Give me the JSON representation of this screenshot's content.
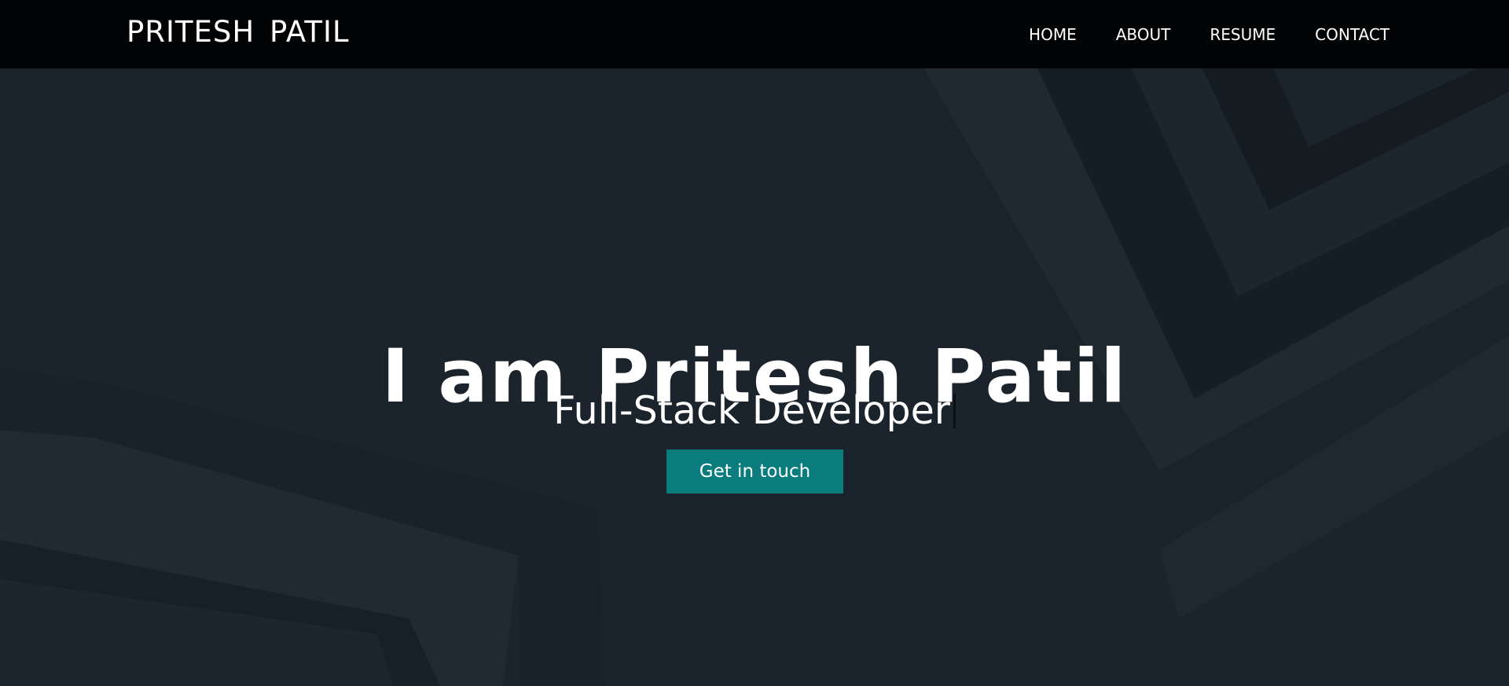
{
  "brand": {
    "name": "PRITESH PATIL"
  },
  "nav": {
    "items": [
      {
        "label": "HOME"
      },
      {
        "label": "ABOUT"
      },
      {
        "label": "RESUME"
      },
      {
        "label": "CONTACT"
      }
    ]
  },
  "hero": {
    "title": "I am Pritesh Patil",
    "subtitle": "Full-Stack Developer",
    "cta_label": "Get in touch"
  },
  "colors": {
    "navbar_bg": "#020304",
    "hero_bg": "#1b242c",
    "accent": "#0a7c7d",
    "text": "#ffffff"
  }
}
